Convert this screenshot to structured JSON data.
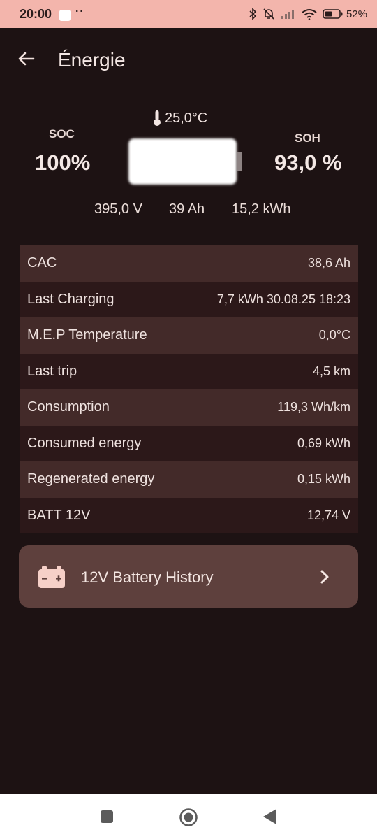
{
  "status_bar": {
    "time": "20:00",
    "dots": "··",
    "battery_percent": "52%"
  },
  "app_bar": {
    "title": "Énergie"
  },
  "battery": {
    "temperature": "25,0°C",
    "soc_label": "SOC",
    "soc_value": "100%",
    "soh_label": "SOH",
    "soh_value": "93,0 %",
    "voltage": "395,0 V",
    "capacity_ah": "39 Ah",
    "energy_kwh": "15,2 kWh",
    "soc_fill_fraction": 1.0
  },
  "table": {
    "rows": [
      {
        "label": "CAC",
        "value": "38,6 Ah"
      },
      {
        "label": "Last Charging",
        "value": "7,7 kWh 30.08.25 18:23"
      },
      {
        "label": "M.E.P Temperature",
        "value": "0,0°C"
      },
      {
        "label": "Last trip",
        "value": "4,5 km"
      },
      {
        "label": "Consumption",
        "value": "119,3 Wh/km"
      },
      {
        "label": "Consumed energy",
        "value": "0,69 kWh"
      },
      {
        "label": "Regenerated energy",
        "value": "0,15 kWh"
      },
      {
        "label": "BATT 12V",
        "value": "12,74 V"
      }
    ]
  },
  "history_button": {
    "label": "12V Battery History",
    "icon": "car-battery-icon"
  },
  "colors": {
    "background": "#1d1213",
    "status_bar": "#f3b5ac",
    "row_light": "#432a29",
    "row_dark": "#2c1819",
    "button": "#5e403d",
    "accent_icon": "#f6d0c8"
  }
}
